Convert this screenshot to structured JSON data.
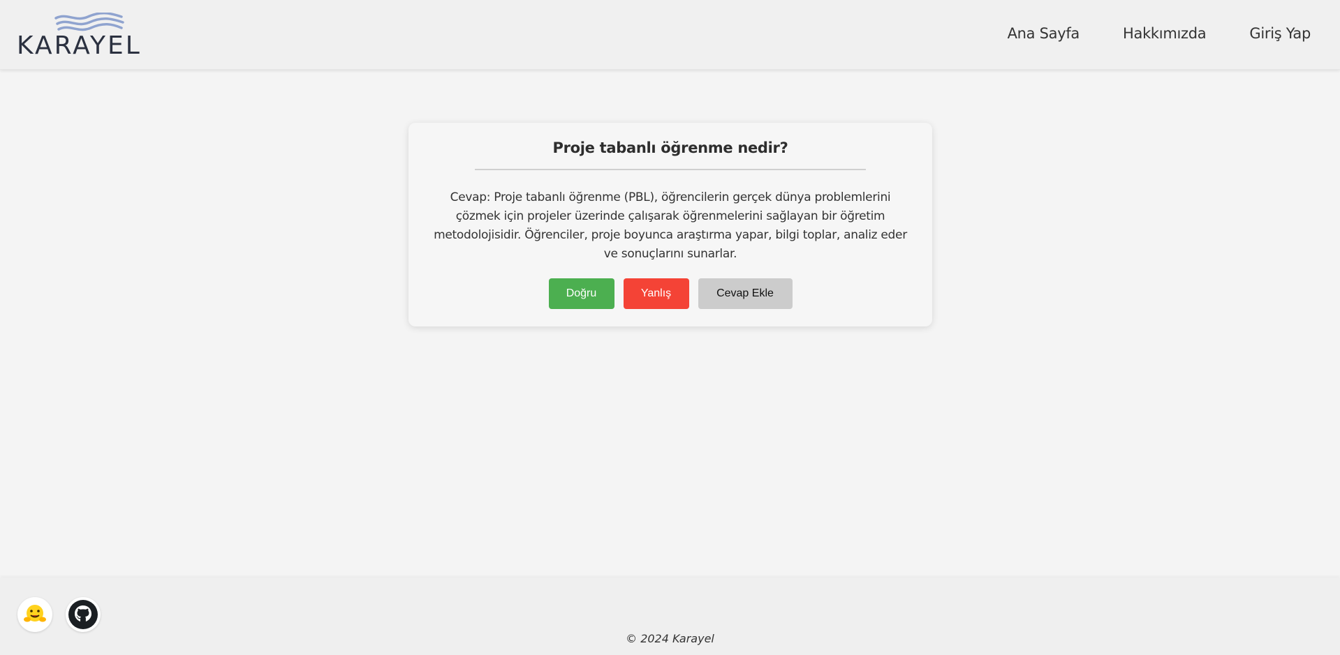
{
  "header": {
    "logo_text": "KARAYEL",
    "nav": [
      {
        "label": "Ana Sayfa"
      },
      {
        "label": "Hakkımızda"
      },
      {
        "label": "Giriş Yap"
      }
    ]
  },
  "card": {
    "question": "Proje tabanlı öğrenme nedir?",
    "answer": "Cevap: Proje tabanlı öğrenme (PBL), öğrencilerin gerçek dünya problemlerini çözmek için projeler üzerinde çalışarak öğrenmelerini sağlayan bir öğretim metodolojisidir. Öğrenciler, proje boyunca araştırma yapar, bilgi toplar, analiz eder ve sonuçlarını sunarlar.",
    "buttons": {
      "true_label": "Doğru",
      "false_label": "Yanlış",
      "add_label": "Cevap Ekle"
    }
  },
  "footer": {
    "icons": [
      "hugging-face-icon",
      "github-icon"
    ],
    "copyright": "© 2024 Karayel"
  },
  "colors": {
    "true_button": "#4caf50",
    "false_button": "#f44336",
    "add_button": "#cccccc",
    "logo_wave": "#8fa3cf"
  }
}
